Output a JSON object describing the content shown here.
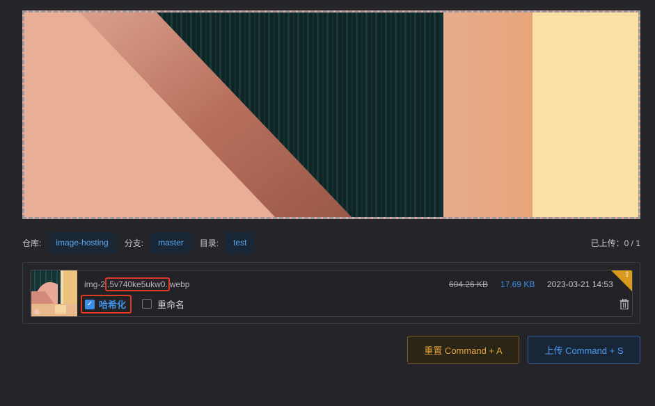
{
  "preview": {
    "image_name": "preview-image"
  },
  "repo": {
    "label": "仓库:",
    "value": "image-hosting"
  },
  "branch": {
    "label": "分支:",
    "value": "master"
  },
  "dir": {
    "label": "目录:",
    "value": "test"
  },
  "upload_progress": "已上传：0 / 1",
  "files": [
    {
      "name_prefix": "img-2",
      "name_hash": ".5v740ke5ukw0.",
      "name_suffix": "webp",
      "original_size": "604.26 KB",
      "compressed_size": "17.69 KB",
      "date": "2023-03-21 14:53",
      "hash_option": {
        "label": "哈希化",
        "checked": true
      },
      "rename_option": {
        "label": "重命名",
        "checked": false
      }
    }
  ],
  "buttons": {
    "reset": "重置 Command + A",
    "upload": "上传 Command + S"
  },
  "colors": {
    "accent_blue": "#3d8fe5",
    "accent_orange": "#e3a239",
    "highlight_red": "#e13a22",
    "background": "#252529"
  },
  "icons": {
    "corner": "upload-arrow-icon",
    "delete": "trash-icon",
    "checkbox_checked": "check-icon"
  }
}
